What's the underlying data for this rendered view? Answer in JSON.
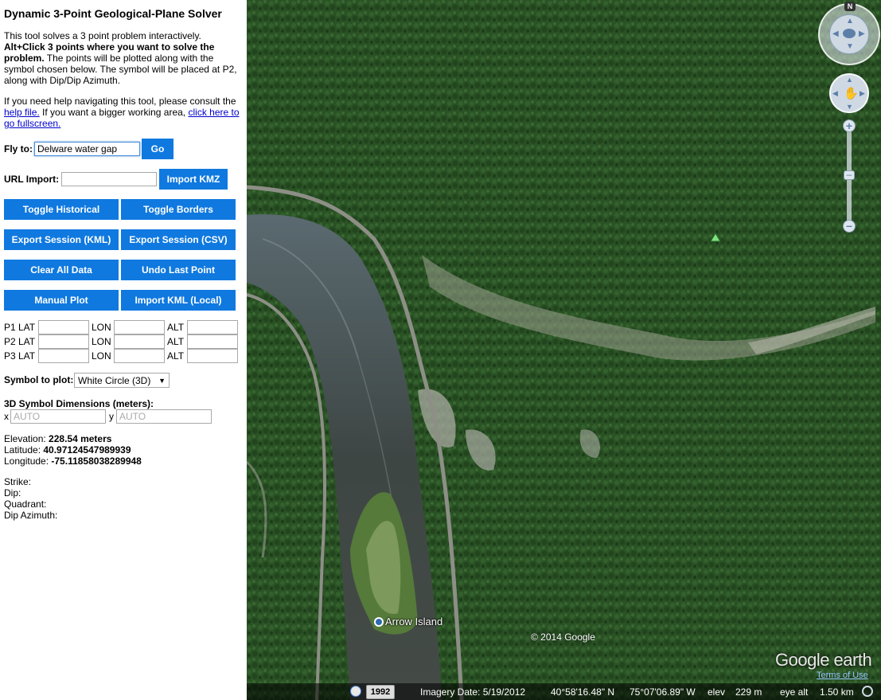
{
  "title": "Dynamic 3-Point Geological-Plane Solver",
  "intro": {
    "line1": "This tool solves a 3 point problem interactively.",
    "bold": "Alt+Click 3 points where you want to solve the problem.",
    "rest": " The points will be plotted along with the symbol chosen below. The symbol will be placed at P2, along with Dip/Dip Azimuth."
  },
  "help": {
    "pre": "If you need help navigating this tool, please consult the ",
    "help_link": "help file.",
    "mid": " If you want a bigger working area, ",
    "full_link": "click here to go fullscreen."
  },
  "fly": {
    "label": "Fly to:",
    "value": "Delware water gap",
    "go": "Go"
  },
  "url": {
    "label": "URL Import:",
    "value": "",
    "button": "Import KMZ"
  },
  "buttons": {
    "toggle_historical": "Toggle Historical",
    "toggle_borders": "Toggle Borders",
    "export_kml": "Export Session (KML)",
    "export_csv": "Export Session (CSV)",
    "clear": "Clear All Data",
    "undo": "Undo Last Point",
    "manual": "Manual Plot",
    "import_kml": "Import KML (Local)"
  },
  "points": [
    {
      "name": "P1 LAT",
      "lon": "LON",
      "alt": "ALT"
    },
    {
      "name": "P2 LAT",
      "lon": "LON",
      "alt": "ALT"
    },
    {
      "name": "P3 LAT",
      "lon": "LON",
      "alt": "ALT"
    }
  ],
  "symbol": {
    "label": "Symbol to plot:",
    "value": "White Circle (3D)"
  },
  "dims": {
    "label": "3D Symbol Dimensions (meters):",
    "x": "x",
    "y": "y",
    "x_placeholder": "AUTO",
    "y_placeholder": "AUTO"
  },
  "stats": {
    "elev_label": "Elevation: ",
    "elev": "228.54 meters",
    "lat_label": "Latitude: ",
    "lat": "40.97124547989939",
    "lon_label": "Longitude: ",
    "lon": "-75.11858038289948",
    "strike": "Strike:",
    "dip": "Dip:",
    "quadrant": "Quadrant:",
    "dip_az": "Dip Azimuth:"
  },
  "map": {
    "place_label": "Arrow Island",
    "copyright": "© 2014 Google",
    "logo": "Google earth",
    "terms": "Terms of Use",
    "compass_n": "N",
    "year": "1992",
    "imagery_date": "Imagery Date: 5/19/2012",
    "lat": "40°58'16.48\" N",
    "lon": "75°07'06.89\" W",
    "elev_label": "elev",
    "elev": "229 m",
    "eye_label": "eye alt",
    "eye": "1.50 km"
  },
  "colors": {
    "button": "#0f79e0",
    "forest": "#2e5a2a",
    "river": "#4a5048"
  }
}
